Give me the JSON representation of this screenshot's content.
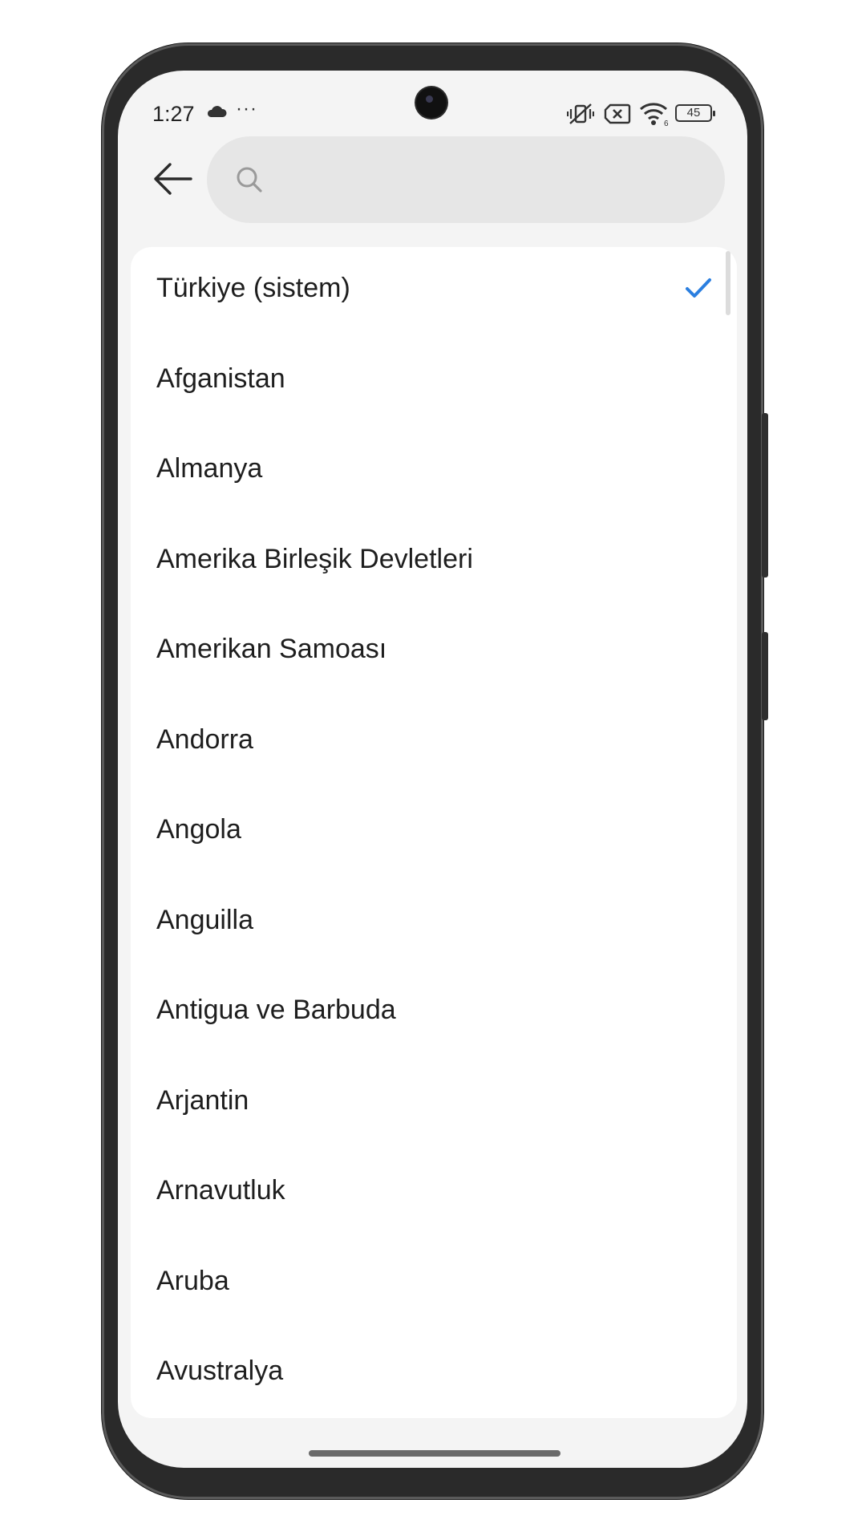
{
  "status_bar": {
    "time": "1:27",
    "more": "···",
    "battery": "45",
    "icons": [
      "cloud-icon",
      "vibrate-off-icon",
      "no-sim-icon",
      "wifi-icon",
      "battery-icon"
    ]
  },
  "header": {
    "back_icon": "arrow-left-icon",
    "search_icon": "search-icon",
    "search_value": "",
    "search_placeholder": ""
  },
  "list": {
    "selected_index": 0,
    "accent_color": "#2b7fe0",
    "items": [
      {
        "label": "Türkiye (sistem)"
      },
      {
        "label": "Afganistan"
      },
      {
        "label": "Almanya"
      },
      {
        "label": "Amerika Birleşik Devletleri"
      },
      {
        "label": "Amerikan Samoası"
      },
      {
        "label": "Andorra"
      },
      {
        "label": "Angola"
      },
      {
        "label": "Anguilla"
      },
      {
        "label": "Antigua ve Barbuda"
      },
      {
        "label": "Arjantin"
      },
      {
        "label": "Arnavutluk"
      },
      {
        "label": "Aruba"
      },
      {
        "label": "Avustralya"
      }
    ]
  }
}
